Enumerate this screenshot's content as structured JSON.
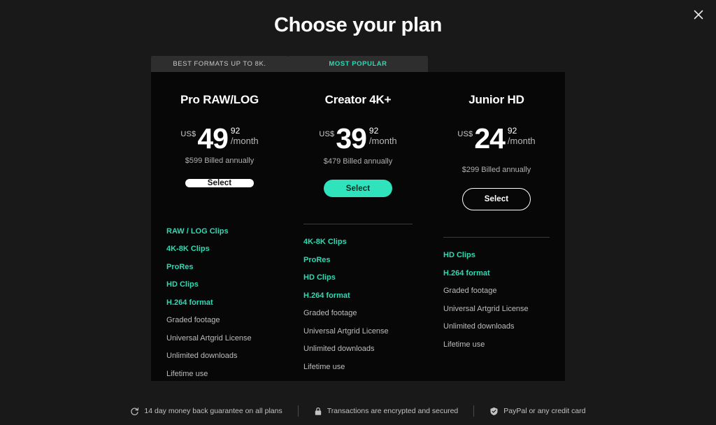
{
  "dialog": {
    "title": "Choose your plan",
    "close_icon": "close-icon"
  },
  "plans": [
    {
      "tab": "BEST FORMATS UP TO 8K.",
      "tab_style": "default",
      "name": "Pro RAW/LOG",
      "currency": "US$",
      "amount": "49",
      "cents": "92",
      "period": "/month",
      "billed": "$599 Billed annually",
      "cta": "Select",
      "cta_style": "white",
      "features": [
        {
          "label": "RAW / LOG Clips",
          "highlighted": true
        },
        {
          "label": "4K-8K Clips",
          "highlighted": true
        },
        {
          "label": "ProRes",
          "highlighted": true
        },
        {
          "label": "HD Clips",
          "highlighted": true
        },
        {
          "label": "H.264 format",
          "highlighted": true
        },
        {
          "label": "Graded footage",
          "highlighted": false
        },
        {
          "label": "Universal Artgrid License",
          "highlighted": false
        },
        {
          "label": "Unlimited downloads",
          "highlighted": false
        },
        {
          "label": "Lifetime use",
          "highlighted": false
        }
      ]
    },
    {
      "tab": "MOST POPULAR",
      "tab_style": "popular",
      "name": "Creator 4K+",
      "currency": "US$",
      "amount": "39",
      "cents": "92",
      "period": "/month",
      "billed": "$479 Billed annually",
      "cta": "Select",
      "cta_style": "teal",
      "features": [
        {
          "label": "4K-8K Clips",
          "highlighted": true
        },
        {
          "label": "ProRes",
          "highlighted": true
        },
        {
          "label": "HD Clips",
          "highlighted": true
        },
        {
          "label": "H.264 format",
          "highlighted": true
        },
        {
          "label": "Graded footage",
          "highlighted": false
        },
        {
          "label": "Universal Artgrid License",
          "highlighted": false
        },
        {
          "label": "Unlimited downloads",
          "highlighted": false
        },
        {
          "label": "Lifetime use",
          "highlighted": false
        }
      ]
    },
    {
      "tab": "",
      "tab_style": "empty",
      "name": "Junior HD",
      "currency": "US$",
      "amount": "24",
      "cents": "92",
      "period": "/month",
      "billed": "$299 Billed annually",
      "cta": "Select",
      "cta_style": "outline",
      "features": [
        {
          "label": "HD Clips",
          "highlighted": true
        },
        {
          "label": "H.264 format",
          "highlighted": true
        },
        {
          "label": "Graded footage",
          "highlighted": false
        },
        {
          "label": "Universal Artgrid License",
          "highlighted": false
        },
        {
          "label": "Unlimited downloads",
          "highlighted": false
        },
        {
          "label": "Lifetime use",
          "highlighted": false
        }
      ]
    }
  ],
  "footer": [
    {
      "icon": "refresh-icon",
      "label": "14 day money back guarantee on all plans"
    },
    {
      "icon": "lock-icon",
      "label": "Transactions are encrypted and secured"
    },
    {
      "icon": "shield-check-icon",
      "label": "PayPal or any credit card"
    }
  ],
  "colors": {
    "accent_teal": "#2fd9b4",
    "button_teal": "#2fe3bc",
    "page_bg": "#191919",
    "card_bg": "#070707",
    "tab_bg": "#2e2e2e"
  }
}
